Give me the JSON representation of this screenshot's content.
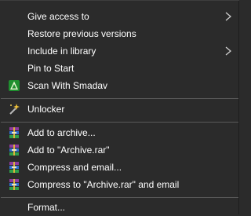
{
  "menu": {
    "items": [
      {
        "label": "Give access to",
        "has_submenu": true
      },
      {
        "label": "Restore previous versions",
        "has_submenu": false
      },
      {
        "label": "Include in library",
        "has_submenu": true
      },
      {
        "label": "Pin to Start",
        "has_submenu": false
      },
      {
        "label": "Scan With Smadav",
        "icon": "smadav-icon"
      },
      {
        "label": "Unlocker",
        "icon": "magic-wand-icon"
      },
      {
        "label": "Add to archive...",
        "icon": "winrar-icon"
      },
      {
        "label": "Add to \"Archive.rar\"",
        "icon": "winrar-icon"
      },
      {
        "label": "Compress and email...",
        "icon": "winrar-icon"
      },
      {
        "label": "Compress to \"Archive.rar\" and email",
        "icon": "winrar-icon"
      },
      {
        "label": "Format...",
        "has_submenu": false
      }
    ]
  },
  "colors": {
    "menu_background": "#2b2b2b",
    "text": "#ffffff",
    "separator": "#5a5a5a"
  }
}
